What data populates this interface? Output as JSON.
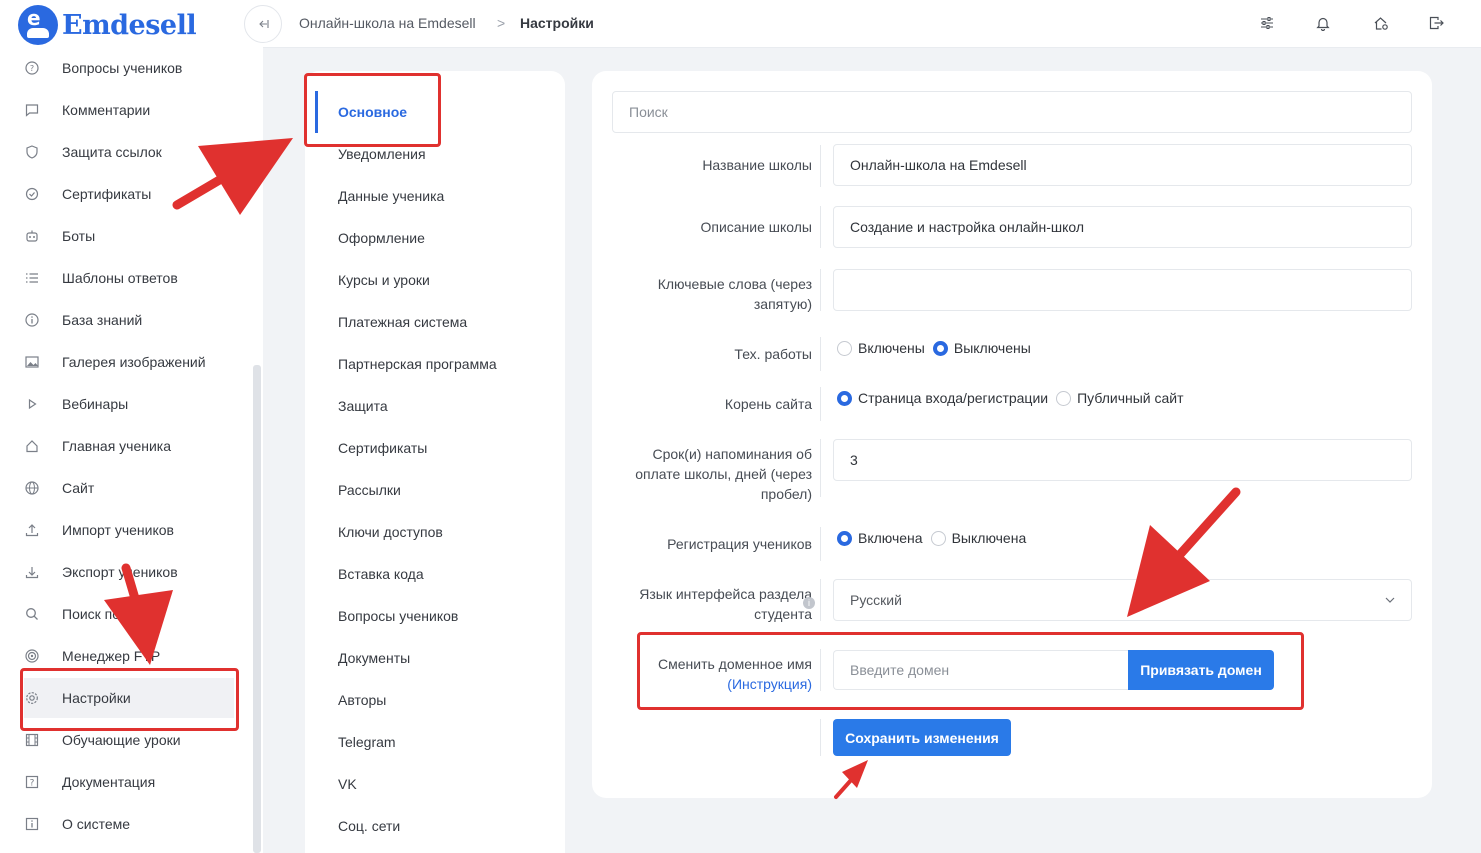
{
  "brand": {
    "name": "Emdesell"
  },
  "sidebar": {
    "items": [
      {
        "label": "Вопросы учеников",
        "icon": "help-circle-icon"
      },
      {
        "label": "Комментарии",
        "icon": "comment-icon"
      },
      {
        "label": "Защита ссылок",
        "icon": "shield-icon"
      },
      {
        "label": "Сертификаты",
        "icon": "certificate-icon"
      },
      {
        "label": "Боты",
        "icon": "bot-icon"
      },
      {
        "label": "Шаблоны ответов",
        "icon": "list-icon"
      },
      {
        "label": "База знаний",
        "icon": "info-icon"
      },
      {
        "label": "Галерея изображений",
        "icon": "image-icon"
      },
      {
        "label": "Вебинары",
        "icon": "play-icon"
      },
      {
        "label": "Главная ученика",
        "icon": "home-icon"
      },
      {
        "label": "Сайт",
        "icon": "globe-icon"
      },
      {
        "label": "Импорт учеников",
        "icon": "upload-icon"
      },
      {
        "label": "Экспорт учеников",
        "icon": "download-icon"
      },
      {
        "label": "Поиск по ключу",
        "icon": "search-icon"
      },
      {
        "label": "Менеджер FTP",
        "icon": "target-icon"
      },
      {
        "label": "Настройки",
        "icon": "gear-icon"
      },
      {
        "label": "Обучающие уроки",
        "icon": "film-icon"
      },
      {
        "label": "Документация",
        "icon": "question-square-icon"
      },
      {
        "label": "О системе",
        "icon": "info-square-icon"
      }
    ]
  },
  "header": {
    "breadcrumb": [
      "Онлайн-школа на Emdesell",
      "Настройки"
    ],
    "breadcrumb_sep": ">",
    "icons": [
      "sliders-icon",
      "bell-icon",
      "home-gear-icon",
      "logout-icon"
    ]
  },
  "settings_menu": {
    "items": [
      "Основное",
      "Уведомления",
      "Данные ученика",
      "Оформление",
      "Курсы и уроки",
      "Платежная система",
      "Партнерская программа",
      "Защита",
      "Сертификаты",
      "Рассылки",
      "Ключи доступов",
      "Вставка кода",
      "Вопросы учеников",
      "Документы",
      "Авторы",
      "Telegram",
      "VK",
      "Соц. сети"
    ]
  },
  "form": {
    "search_placeholder": "Поиск",
    "school_name": {
      "label": "Название школы",
      "value": "Онлайн-школа на Emdesell"
    },
    "school_desc": {
      "label": "Описание школы",
      "value": "Создание и настройка онлайн-школ"
    },
    "keywords": {
      "label_1": "Ключевые слова (через",
      "label_2": "запятую)",
      "value": ""
    },
    "maintenance": {
      "label": "Тех. работы",
      "opt_on": "Включены",
      "opt_off": "Выключены",
      "selected": "off"
    },
    "site_root": {
      "label": "Корень сайта",
      "opt_1": "Страница входа/регистрации",
      "opt_2": "Публичный сайт",
      "selected": "1"
    },
    "reminder": {
      "label_1": "Срок(и) напоминания об",
      "label_2": "оплате школы, дней (через",
      "label_3": "пробел)",
      "value": "3"
    },
    "registration": {
      "label": "Регистрация учеников",
      "opt_on": "Включена",
      "opt_off": "Выключена",
      "selected": "on"
    },
    "language": {
      "label_1": "Язык интерфейса раздела",
      "label_2": "студента",
      "value": "Русский"
    },
    "domain": {
      "label_1": "Сменить доменное имя",
      "label_2": "(Инструкция)",
      "placeholder": "Введите домен",
      "button": "Привязать домен"
    },
    "save_button": "Сохранить изменения"
  },
  "colors": {
    "accent": "#2a69e0",
    "button": "#2a7ae8",
    "annotation": "#e0312f"
  }
}
